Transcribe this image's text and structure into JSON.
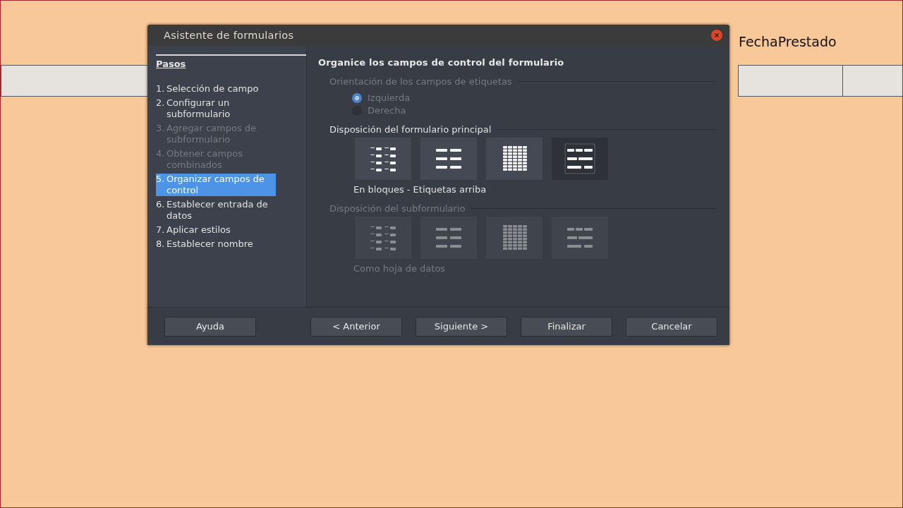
{
  "background": {
    "field_label": "FechaPrestado"
  },
  "window": {
    "title": "Asistente de formularios"
  },
  "steps_heading": "Pasos",
  "steps": [
    {
      "number": "1.",
      "label": "Selección de campo",
      "disabled": false,
      "selected": false
    },
    {
      "number": "2.",
      "label": "Configurar un subformulario",
      "disabled": false,
      "selected": false
    },
    {
      "number": "3.",
      "label": "Agregar campos de subformulario",
      "disabled": true,
      "selected": false
    },
    {
      "number": "4.",
      "label": "Obtener campos combinados",
      "disabled": true,
      "selected": false
    },
    {
      "number": "5.",
      "label": "Organizar campos de control",
      "disabled": false,
      "selected": true
    },
    {
      "number": "6.",
      "label": "Establecer entrada de datos",
      "disabled": false,
      "selected": false
    },
    {
      "number": "7.",
      "label": "Aplicar estilos",
      "disabled": false,
      "selected": false
    },
    {
      "number": "8.",
      "label": "Establecer nombre",
      "disabled": false,
      "selected": false
    }
  ],
  "page_title": "Organice los campos de control del formulario",
  "label_orientation": {
    "heading": "Orientación de los campos de etiquetas",
    "disabled": true,
    "options": [
      {
        "label": "Izquierda",
        "selected": true
      },
      {
        "label": "Derecha",
        "selected": false
      }
    ]
  },
  "main_layout": {
    "heading": "Disposición del formulario principal",
    "disabled": false,
    "caption": "En bloques - Etiquetas arriba",
    "options": [
      {
        "kind": "columns-left",
        "selected": false
      },
      {
        "kind": "columns-top",
        "selected": false
      },
      {
        "kind": "datasheet",
        "selected": false
      },
      {
        "kind": "blocks-top",
        "selected": true
      }
    ]
  },
  "sub_layout": {
    "heading": "Disposición del subformulario",
    "disabled": true,
    "caption": "Como hoja de datos",
    "options": [
      {
        "kind": "columns-left",
        "selected": false
      },
      {
        "kind": "columns-top",
        "selected": false
      },
      {
        "kind": "datasheet",
        "selected": false
      },
      {
        "kind": "blocks-top",
        "selected": false
      }
    ]
  },
  "buttons": {
    "help": "Ayuda",
    "nav": [
      "< Anterior",
      "Siguiente >",
      "Finalizar",
      "Cancelar"
    ]
  }
}
